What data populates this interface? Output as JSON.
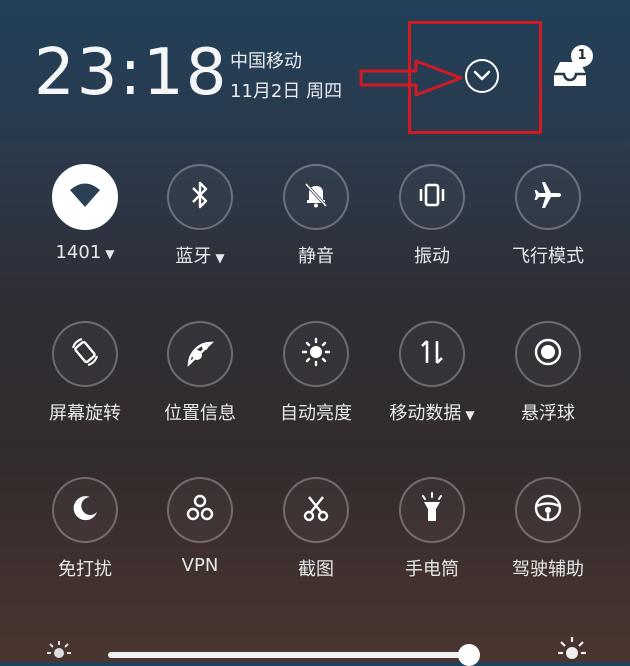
{
  "status": {
    "time": "23:18",
    "carrier": "中国移动",
    "date": "11月2日 周四",
    "notification_count": "1"
  },
  "tiles": [
    {
      "label": "1401",
      "caret": "▼",
      "icon": "wifi-icon",
      "active": true
    },
    {
      "label": "蓝牙",
      "caret": "▼",
      "icon": "bluetooth-icon",
      "active": false
    },
    {
      "label": "静音",
      "caret": "",
      "icon": "bell-off-icon",
      "active": false
    },
    {
      "label": "振动",
      "caret": "",
      "icon": "vibrate-icon",
      "active": false
    },
    {
      "label": "飞行模式",
      "caret": "",
      "icon": "airplane-icon",
      "active": false
    },
    {
      "label": "屏幕旋转",
      "caret": "",
      "icon": "rotate-icon",
      "active": false
    },
    {
      "label": "位置信息",
      "caret": "",
      "icon": "location-icon",
      "active": false
    },
    {
      "label": "自动亮度",
      "caret": "",
      "icon": "brightness-icon",
      "active": false
    },
    {
      "label": "移动数据",
      "caret": "▼",
      "icon": "data-icon",
      "active": false
    },
    {
      "label": "悬浮球",
      "caret": "",
      "icon": "float-ball-icon",
      "active": false
    },
    {
      "label": "免打扰",
      "caret": "",
      "icon": "moon-icon",
      "active": false
    },
    {
      "label": "VPN",
      "caret": "",
      "icon": "vpn-icon",
      "active": false
    },
    {
      "label": "截图",
      "caret": "",
      "icon": "scissors-icon",
      "active": false
    },
    {
      "label": "手电筒",
      "caret": "",
      "icon": "flashlight-icon",
      "active": false
    },
    {
      "label": "驾驶辅助",
      "caret": "",
      "icon": "steering-icon",
      "active": false
    }
  ],
  "brightness": {
    "level": 0.98
  },
  "colors": {
    "annotation": "#d11a24",
    "active_tile": "#ffffff"
  }
}
